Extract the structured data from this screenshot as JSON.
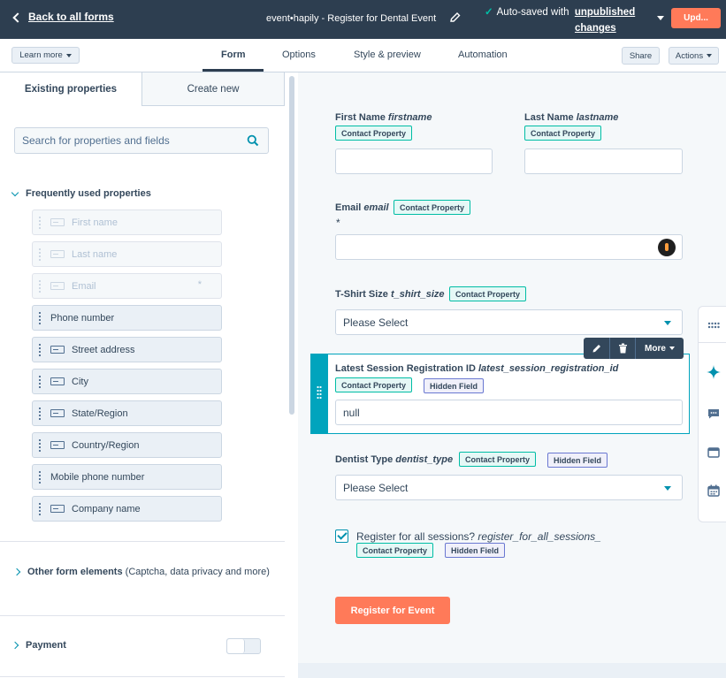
{
  "topbar": {
    "back_label": "Back to all forms",
    "form_title": "event•hapily - Register for Dental Event",
    "autosave_text": "Auto-saved with",
    "autosave_link_1": "unpublished",
    "autosave_link_2": "changes",
    "update_label": "Upd..."
  },
  "subbar": {
    "learn_more": "Learn more",
    "tabs": [
      "Form",
      "Options",
      "Style & preview",
      "Automation"
    ],
    "active_tab": "Form",
    "share": "Share",
    "actions": "Actions"
  },
  "left_panel": {
    "tabs": {
      "existing": "Existing properties",
      "create": "Create new"
    },
    "search_placeholder": "Search for properties and fields",
    "frequent_title": "Frequently used properties",
    "properties": [
      {
        "label": "First name",
        "disabled": true,
        "required": false,
        "icon": "field-icon"
      },
      {
        "label": "Last name",
        "disabled": true,
        "required": false,
        "icon": "field-icon"
      },
      {
        "label": "Email",
        "disabled": true,
        "required": true,
        "icon": "field-icon"
      },
      {
        "label": "Phone number",
        "disabled": false,
        "required": false,
        "icon": ""
      },
      {
        "label": "Street address",
        "disabled": false,
        "required": false,
        "icon": "field-icon"
      },
      {
        "label": "City",
        "disabled": false,
        "required": false,
        "icon": "field-icon"
      },
      {
        "label": "State/Region",
        "disabled": false,
        "required": false,
        "icon": "field-icon"
      },
      {
        "label": "Country/Region",
        "disabled": false,
        "required": false,
        "icon": "field-icon"
      },
      {
        "label": "Mobile phone number",
        "disabled": false,
        "required": false,
        "icon": ""
      },
      {
        "label": "Company name",
        "disabled": false,
        "required": false,
        "icon": "field-icon"
      }
    ],
    "required_mark": "*",
    "other_title": "Other form elements",
    "other_sub": "(Captcha, data privacy and more)",
    "payment_title": "Payment"
  },
  "form": {
    "first_name": {
      "label": "First Name",
      "internal": "firstname",
      "badge": "Contact Property",
      "value": ""
    },
    "last_name": {
      "label": "Last Name",
      "internal": "lastname",
      "badge": "Contact Property",
      "value": ""
    },
    "email": {
      "label": "Email",
      "internal": "email",
      "badge": "Contact Property",
      "required_mark": "*",
      "value": ""
    },
    "tshirt": {
      "label": "T-Shirt Size",
      "internal": "t_shirt_size",
      "badge": "Contact Property",
      "value": "Please Select"
    },
    "session": {
      "label": "Latest Session Registration ID",
      "internal": "latest_session_registration_id",
      "badge": "Contact Property",
      "badge2": "Hidden Field",
      "value": "null"
    },
    "dentist": {
      "label": "Dentist Type",
      "internal": "dentist_type",
      "badge": "Contact Property",
      "badge2": "Hidden Field",
      "value": "Please Select"
    },
    "register_all": {
      "label": "Register for all sessions?",
      "internal": "register_for_all_sessions_",
      "badge": "Contact Property",
      "badge2": "Hidden Field",
      "checked": true
    },
    "submit_label": "Register for Event",
    "toolbar_more": "More"
  },
  "colors": {
    "accent": "#00a4bd",
    "primary": "#ff7a59",
    "topbar": "#2d3e50",
    "teal": "#00bda5"
  }
}
